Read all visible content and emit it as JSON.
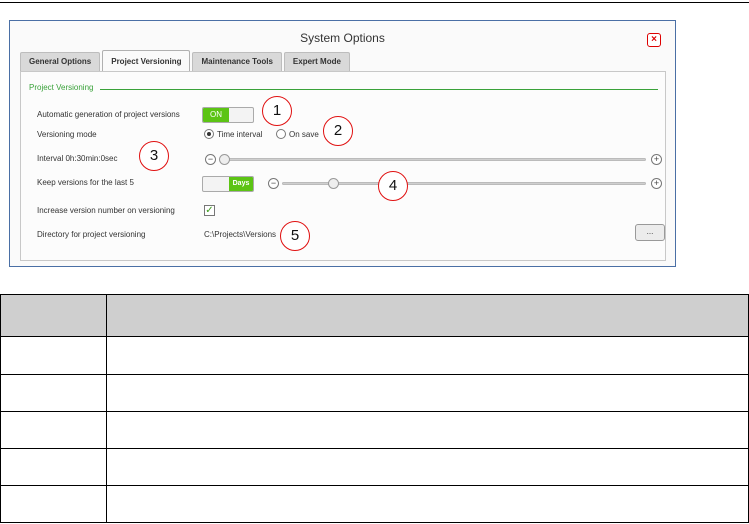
{
  "window": {
    "title": "System Options",
    "close_symbol": "×"
  },
  "tabs": [
    {
      "label": "General Options",
      "active": false
    },
    {
      "label": "Project Versioning",
      "active": true
    },
    {
      "label": "Maintenance Tools",
      "active": false
    },
    {
      "label": "Expert Mode",
      "active": false
    }
  ],
  "section": {
    "title": "Project Versioning"
  },
  "settings": {
    "auto_gen": {
      "label": "Automatic generation of project versions",
      "toggle_label": "ON",
      "value": true
    },
    "mode": {
      "label": "Versioning mode",
      "options": [
        "Time interval",
        "On save"
      ],
      "selected": "Time interval"
    },
    "interval": {
      "label": "Interval 0h:30min:0sec",
      "slider_fraction": 0.0
    },
    "keep": {
      "label": "Keep versions for the last 5",
      "toggle_label": "Days",
      "slider_fraction": 0.13
    },
    "increase": {
      "label": "Increase version number on versioning",
      "checked": true,
      "check_mark": "✓"
    },
    "directory": {
      "label": "Directory for project versioning",
      "value": "C:\\Projects\\Versions",
      "button_label": "..."
    }
  },
  "slider_controls": {
    "minus": "−",
    "plus": "+"
  },
  "callouts": [
    "1",
    "2",
    "3",
    "4",
    "5"
  ],
  "table": {
    "headers": [
      "",
      ""
    ],
    "rows": [
      [
        "",
        ""
      ],
      [
        "",
        ""
      ],
      [
        "",
        ""
      ],
      [
        "",
        ""
      ],
      [
        "",
        ""
      ]
    ]
  },
  "colors": {
    "accent_green": "#5cc414",
    "section_green": "#3aa23a",
    "callout_red": "#e01010",
    "table_header": "#cfcfcf"
  }
}
